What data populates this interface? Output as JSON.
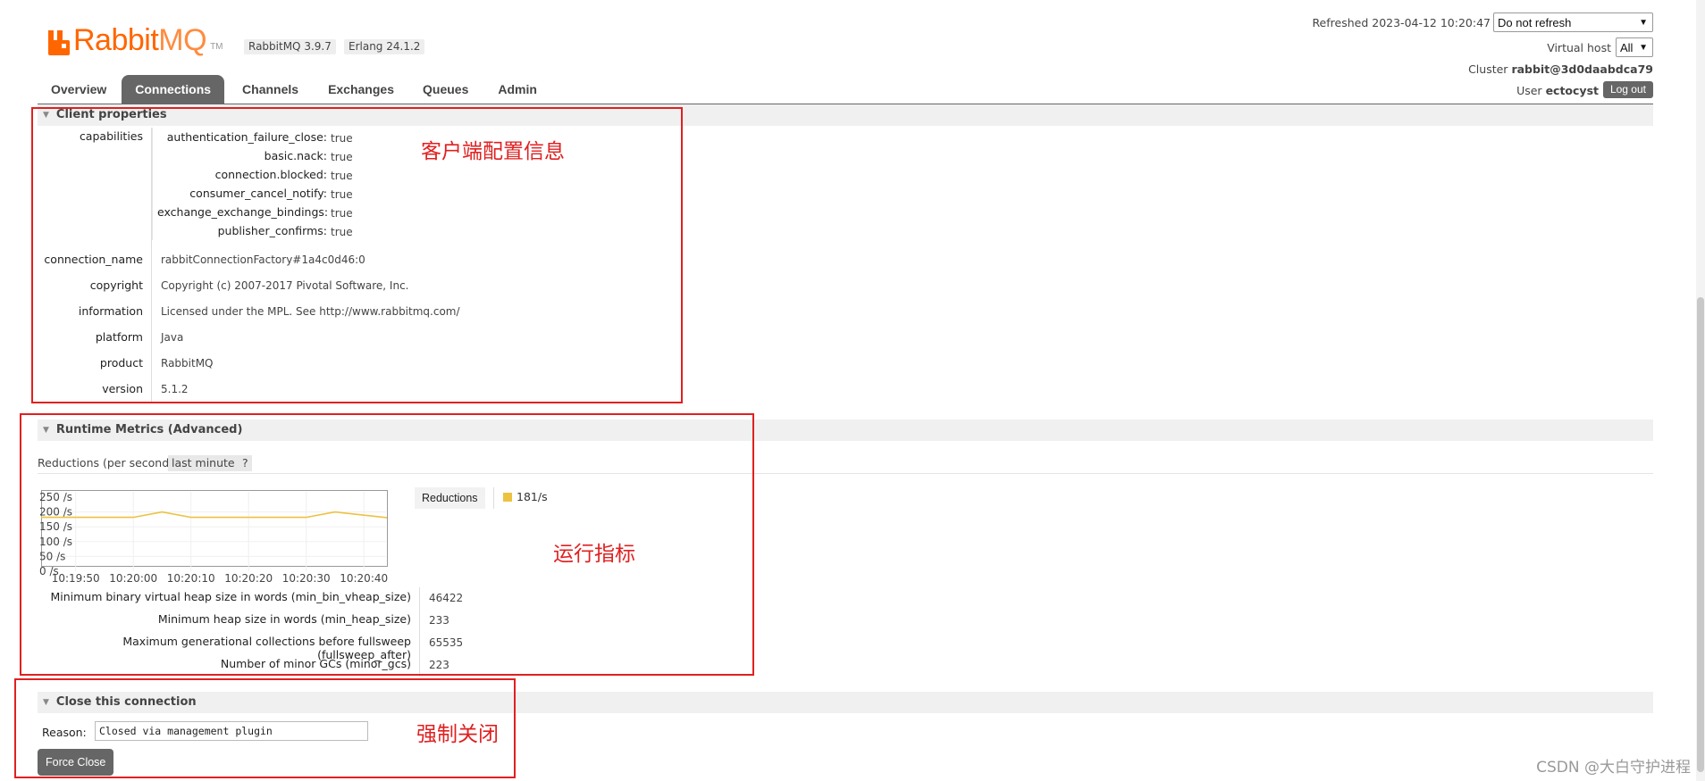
{
  "header": {
    "logo_text_rabbit": "Rabbit",
    "logo_text_mq": "MQ",
    "logo_tm": "TM",
    "rabbitmq_version": "RabbitMQ 3.9.7",
    "erlang_version": "Erlang 24.1.2",
    "refreshed_label": "Refreshed 2023-04-12 10:20:47",
    "refresh_select": "Do not refresh",
    "virtual_host_label": "Virtual host",
    "virtual_host_select": "All",
    "cluster_label": "Cluster",
    "cluster_name": "rabbit@3d0daabdca79",
    "user_label": "User",
    "user_name": "ectocyst",
    "logout_label": "Log out"
  },
  "tabs": [
    {
      "label": "Overview",
      "active": false
    },
    {
      "label": "Connections",
      "active": true
    },
    {
      "label": "Channels",
      "active": false
    },
    {
      "label": "Exchanges",
      "active": false
    },
    {
      "label": "Queues",
      "active": false
    },
    {
      "label": "Admin",
      "active": false
    }
  ],
  "client_properties": {
    "title": "Client properties",
    "capabilities_key": "capabilities",
    "capabilities": [
      {
        "key": "authentication_failure_close:",
        "value": "true"
      },
      {
        "key": "basic.nack:",
        "value": "true"
      },
      {
        "key": "connection.blocked:",
        "value": "true"
      },
      {
        "key": "consumer_cancel_notify:",
        "value": "true"
      },
      {
        "key": "exchange_exchange_bindings:",
        "value": "true"
      },
      {
        "key": "publisher_confirms:",
        "value": "true"
      }
    ],
    "rows": [
      {
        "key": "connection_name",
        "value": "rabbitConnectionFactory#1a4c0d46:0"
      },
      {
        "key": "copyright",
        "value": "Copyright (c) 2007-2017 Pivotal Software, Inc."
      },
      {
        "key": "information",
        "value": "Licensed under the MPL. See http://www.rabbitmq.com/"
      },
      {
        "key": "platform",
        "value": "Java"
      },
      {
        "key": "product",
        "value": "RabbitMQ"
      },
      {
        "key": "version",
        "value": "5.1.2"
      }
    ]
  },
  "runtime_metrics": {
    "title": "Runtime Metrics (Advanced)",
    "reductions_label": "Reductions (per second)",
    "range_tag": "last minute",
    "help_tag": "?",
    "legend_label": "Reductions",
    "legend_value": "181/s",
    "series_color": "#edc240",
    "metrics": [
      {
        "key": "Minimum binary virtual heap size in words (min_bin_vheap_size)",
        "value": "46422"
      },
      {
        "key": "Minimum heap size in words (min_heap_size)",
        "value": "233"
      },
      {
        "key": "Maximum generational collections before fullsweep (fullsweep_after)",
        "value": "65535"
      },
      {
        "key": "Number of minor GCs (minor_gcs)",
        "value": "223"
      }
    ]
  },
  "chart_data": {
    "type": "line",
    "title": "",
    "xlabel": "",
    "ylabel": "",
    "ylim": [
      0,
      250
    ],
    "y_ticks": [
      "250 /s",
      "200 /s",
      "150 /s",
      "100 /s",
      "50 /s",
      "0 /s"
    ],
    "x_ticks": [
      "10:19:50",
      "10:20:00",
      "10:20:10",
      "10:20:20",
      "10:20:30",
      "10:20:40"
    ],
    "series": [
      {
        "name": "Reductions",
        "x": [
          "10:19:44",
          "10:19:50",
          "10:19:55",
          "10:20:00",
          "10:20:05",
          "10:20:10",
          "10:20:15",
          "10:20:20",
          "10:20:25",
          "10:20:30",
          "10:20:35",
          "10:20:44"
        ],
        "values": [
          182,
          182,
          182,
          182,
          200,
          182,
          182,
          182,
          182,
          182,
          200,
          181
        ]
      }
    ]
  },
  "close_connection": {
    "title": "Close this connection",
    "reason_label": "Reason:",
    "reason_value": "Closed via management plugin",
    "force_close_label": "Force Close"
  },
  "annotations": {
    "client": "客户端配置信息",
    "runtime": "运行指标",
    "close": "强制关闭",
    "color": "#e02020"
  },
  "watermark": "CSDN @大白守护进程"
}
